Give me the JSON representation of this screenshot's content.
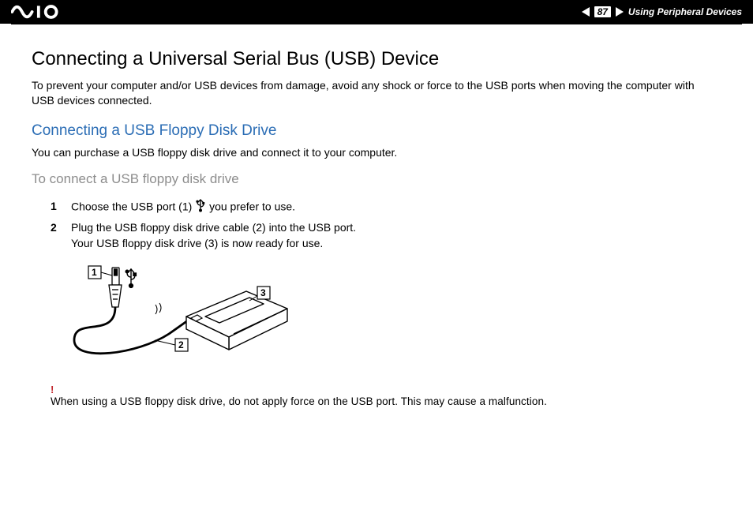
{
  "header": {
    "logo_text": "VAIO",
    "page_number": "87",
    "section": "Using Peripheral Devices"
  },
  "main": {
    "title": "Connecting a Universal Serial Bus (USB) Device",
    "intro": "To prevent your computer and/or USB devices from damage, avoid any shock or force to the USB ports when moving the computer with USB devices connected.",
    "subheading": "Connecting a USB Floppy Disk Drive",
    "subtext": "You can purchase a USB floppy disk drive and connect it to your computer.",
    "task_heading": "To connect a USB floppy disk drive",
    "steps": {
      "s1a": "Choose the USB port (1) ",
      "s1b": " you prefer to use.",
      "s2a": "Plug the USB floppy disk drive cable (2) into the USB port.",
      "s2b": "Your USB floppy disk drive (3) is now ready for use."
    },
    "callouts": {
      "c1": "1",
      "c2": "2",
      "c3": "3"
    },
    "warning": {
      "bang": "!",
      "text": "When using a USB floppy disk drive, do not apply force on the USB port. This may cause a malfunction."
    },
    "icons": {
      "usb": "usb-trident-icon"
    }
  }
}
